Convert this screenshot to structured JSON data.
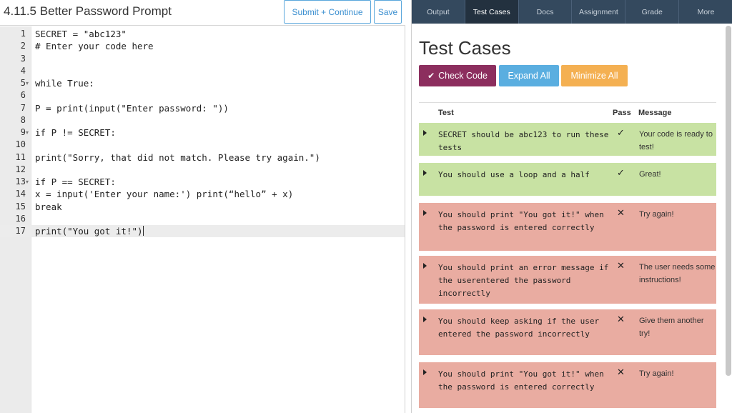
{
  "editor": {
    "title": "4.11.5 Better Password Prompt",
    "submit_label": "Submit + Continue",
    "save_label": "Save",
    "lines": [
      {
        "n": "1",
        "fold": "",
        "text": "SECRET = \"abc123\""
      },
      {
        "n": "2",
        "fold": "",
        "text": "# Enter your code here"
      },
      {
        "n": "3",
        "fold": "",
        "text": ""
      },
      {
        "n": "4",
        "fold": "",
        "text": ""
      },
      {
        "n": "5",
        "fold": "▾",
        "text": "while True:"
      },
      {
        "n": "6",
        "fold": "",
        "text": ""
      },
      {
        "n": "7",
        "fold": "",
        "text": "P = print(input(\"Enter password: \"))"
      },
      {
        "n": "8",
        "fold": "",
        "text": ""
      },
      {
        "n": "9",
        "fold": "▾",
        "text": "if P != SECRET:"
      },
      {
        "n": "10",
        "fold": "",
        "text": ""
      },
      {
        "n": "11",
        "fold": "",
        "text": "print(\"Sorry, that did not match. Please try again.\")"
      },
      {
        "n": "12",
        "fold": "",
        "text": ""
      },
      {
        "n": "13",
        "fold": "▾",
        "text": "if P == SECRET:"
      },
      {
        "n": "14",
        "fold": "",
        "text": "x = input('Enter your name:') print(“hello” + x)"
      },
      {
        "n": "15",
        "fold": "",
        "text": "break"
      },
      {
        "n": "16",
        "fold": "",
        "text": ""
      },
      {
        "n": "17",
        "fold": "",
        "text": "print(\"You got it!\")"
      }
    ]
  },
  "tabs": [
    {
      "label": "Output",
      "active": false
    },
    {
      "label": "Test Cases",
      "active": true
    },
    {
      "label": "Docs",
      "active": false
    },
    {
      "label": "Assignment",
      "active": false
    },
    {
      "label": "Grade",
      "active": false
    },
    {
      "label": "More",
      "active": false
    }
  ],
  "tests": {
    "heading": "Test Cases",
    "check_label": "Check Code",
    "expand_label": "Expand All",
    "minimize_label": "Minimize All",
    "col_test": "Test",
    "col_pass": "Pass",
    "col_message": "Message",
    "rows": [
      {
        "test": "SECRET should be abc123 to run these tests",
        "passed": true,
        "mark": "✓",
        "message": "Your code is ready to test!"
      },
      {
        "test": "You should use a loop and a half",
        "passed": true,
        "mark": "✓",
        "message": "Great!"
      },
      {
        "test": "You should print \"You got it!\" when the password is entered correctly",
        "passed": false,
        "mark": "✕",
        "message": "Try again!"
      },
      {
        "test": "You should print an error message if the userentered the password incorrectly",
        "passed": false,
        "mark": "✕",
        "message": "The user needs some instructions!"
      },
      {
        "test": "You should keep asking if the user entered the password incorrectly",
        "passed": false,
        "mark": "✕",
        "message": "Give them another try!"
      },
      {
        "test": "You should print \"You got it!\" when the password is entered correctly",
        "passed": false,
        "mark": "✕",
        "message": "Try again!"
      }
    ]
  },
  "colors": {
    "tab_bar": "#34495e",
    "check_button": "#8c2e5e",
    "expand_button": "#5aaee0",
    "minimize_button": "#f4b052",
    "pass_row": "#c8e2a3",
    "fail_row": "#e9aca1"
  }
}
